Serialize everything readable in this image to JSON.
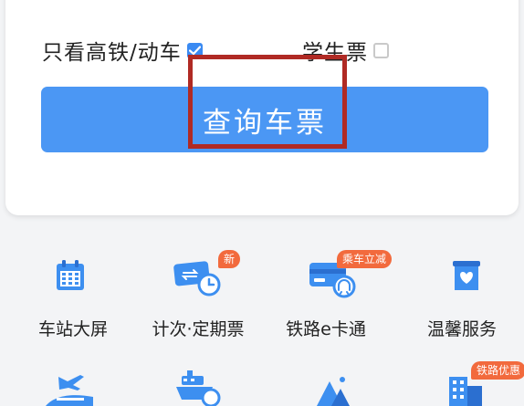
{
  "options": {
    "high_speed_label": "只看高铁/动车",
    "high_speed_checked": true,
    "student_label": "学生票",
    "student_checked": false
  },
  "query_button": {
    "label": "查询车票"
  },
  "services": [
    {
      "label": "车站大屏",
      "icon": "station-screen-calendar-icon",
      "badge": ""
    },
    {
      "label": "计次·定期票",
      "icon": "ticket-pass-icon",
      "badge": "新"
    },
    {
      "label": "铁路e卡通",
      "icon": "railway-card-icon",
      "badge": "乘车立减"
    },
    {
      "label": "温馨服务",
      "icon": "heart-service-icon",
      "badge": ""
    }
  ],
  "row2": [
    {
      "icon": "airplane-train-icon",
      "badge": ""
    },
    {
      "icon": "ship-icon",
      "badge": ""
    },
    {
      "icon": "scenic-mountain-icon",
      "badge": ""
    },
    {
      "icon": "hotel-building-icon",
      "badge": "铁路优惠"
    }
  ],
  "colors": {
    "primary": "#4b97f4",
    "checkbox_on": "#3a8af2",
    "badge": "#f26a3d",
    "highlight_border": "#b02a24"
  }
}
